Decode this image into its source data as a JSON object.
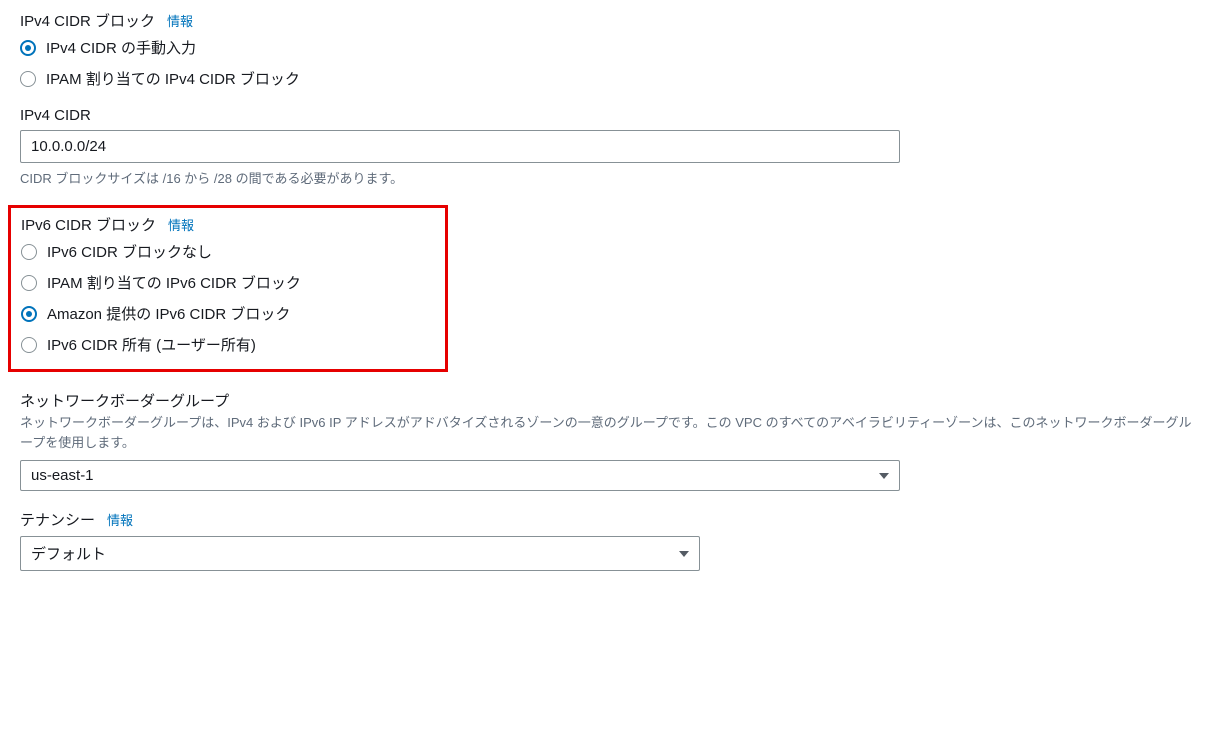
{
  "ipv4Block": {
    "label": "IPv4 CIDR ブロック",
    "info": "情報",
    "options": [
      "IPv4 CIDR の手動入力",
      "IPAM 割り当ての IPv4 CIDR ブロック"
    ],
    "selectedIndex": 0
  },
  "ipv4Cidr": {
    "label": "IPv4 CIDR",
    "value": "10.0.0.0/24",
    "helper": "CIDR ブロックサイズは /16 から /28 の間である必要があります。"
  },
  "ipv6Block": {
    "label": "IPv6 CIDR ブロック",
    "info": "情報",
    "options": [
      "IPv6 CIDR ブロックなし",
      "IPAM 割り当ての IPv6 CIDR ブロック",
      "Amazon 提供の IPv6 CIDR ブロック",
      "IPv6 CIDR 所有 (ユーザー所有)"
    ],
    "selectedIndex": 2
  },
  "networkBorderGroup": {
    "label": "ネットワークボーダーグループ",
    "description": "ネットワークボーダーグループは、IPv4 および IPv6 IP アドレスがアドバタイズされるゾーンの一意のグループです。この VPC のすべてのアベイラビリティーゾーンは、このネットワークボーダーグループを使用します。",
    "value": "us-east-1"
  },
  "tenancy": {
    "label": "テナンシー",
    "info": "情報",
    "value": "デフォルト"
  }
}
